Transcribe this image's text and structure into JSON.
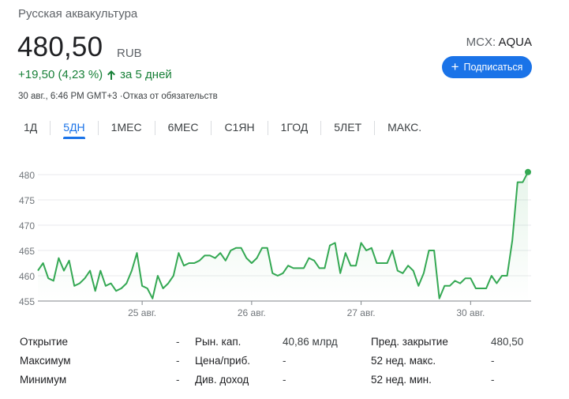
{
  "header": {
    "company": "Русская аквакультура",
    "price": "480,50",
    "currency": "RUB",
    "change": "+19,50 (4,23 %)",
    "change_period": "за 5 дней",
    "meta": "30 авг., 6:46 PM GMT+3 ·Отказ от обязательств",
    "exchange": "MCX: ",
    "symbol": "AQUA",
    "subscribe_label": "Подписаться",
    "colors": {
      "up": "#188038",
      "accent": "#1a73e8"
    }
  },
  "tabs": [
    {
      "label": "1Д",
      "active": false
    },
    {
      "label": "5ДН",
      "active": true
    },
    {
      "label": "1МЕС",
      "active": false
    },
    {
      "label": "6МЕС",
      "active": false
    },
    {
      "label": "С1ЯН",
      "active": false
    },
    {
      "label": "1ГОД",
      "active": false
    },
    {
      "label": "5ЛЕТ",
      "active": false
    },
    {
      "label": "МАКС.",
      "active": false
    }
  ],
  "chart_data": {
    "type": "line",
    "ylim": [
      455,
      482
    ],
    "yticks": [
      "480",
      "475",
      "470",
      "465",
      "460",
      "455"
    ],
    "ytick_values": [
      480,
      475,
      470,
      465,
      460,
      455
    ],
    "xticks": [
      "25 авг.",
      "26 авг.",
      "27 авг.",
      "30 авг."
    ],
    "xtick_index": [
      20,
      41,
      62,
      83
    ],
    "series": [
      {
        "color": "#34a853",
        "values": [
          461,
          462.5,
          459.5,
          459,
          463.5,
          461,
          463,
          458,
          458.5,
          459.5,
          461,
          457,
          461,
          458,
          458.5,
          457,
          457.5,
          458.5,
          461,
          464.5,
          458,
          457.5,
          455.5,
          460,
          457.5,
          458.5,
          460,
          464.5,
          462,
          462.5,
          462.5,
          463,
          464,
          464,
          463.5,
          464.5,
          463,
          465,
          465.5,
          465.5,
          463.5,
          462.5,
          463.5,
          465.5,
          465.5,
          460.5,
          460,
          460.5,
          462,
          461.5,
          461.5,
          461.5,
          463.5,
          463,
          461.5,
          461.5,
          466,
          466.5,
          460.5,
          464.5,
          462,
          462,
          466.5,
          465,
          465.5,
          462.5,
          462.5,
          462.5,
          465,
          461,
          460.5,
          462,
          461,
          458,
          460.5,
          465,
          465,
          455.5,
          458,
          458,
          459,
          458.5,
          459.5,
          459.5,
          457.5,
          457.5,
          457.5,
          460,
          458.5,
          460,
          460,
          467,
          478.5,
          478.5,
          480.5
        ]
      }
    ]
  },
  "stats": [
    [
      {
        "label": "Открытие",
        "value": "-"
      },
      {
        "label": "Максимум",
        "value": "-"
      },
      {
        "label": "Минимум",
        "value": "-"
      }
    ],
    [
      {
        "label": "Рын. кап.",
        "value": "40,86 млрд"
      },
      {
        "label": "Цена/приб.",
        "value": "-"
      },
      {
        "label": "Див. доход",
        "value": "-"
      }
    ],
    [
      {
        "label": "Пред. закрытие",
        "value": "480,50"
      },
      {
        "label": "52 нед. макс.",
        "value": "-"
      },
      {
        "label": "52 нед. мин.",
        "value": "-"
      }
    ]
  ]
}
